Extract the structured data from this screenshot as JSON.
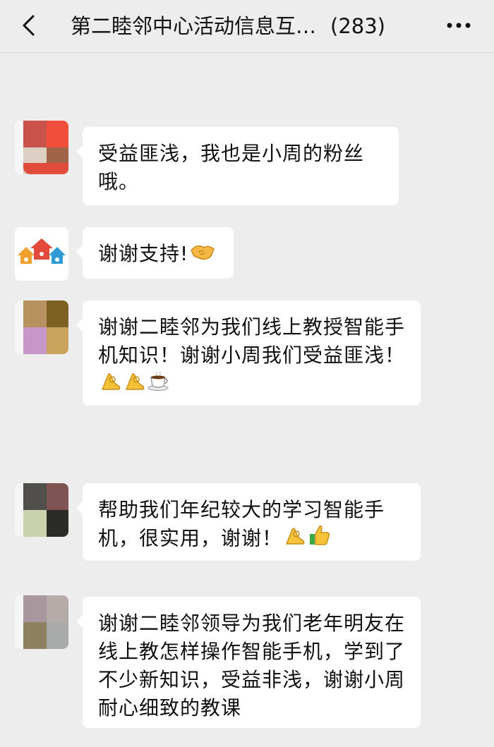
{
  "header": {
    "title": "第二睦邻中心活动信息互…",
    "member_count": "(283)",
    "back_icon": "chevron-left-icon",
    "more_icon": "more-dots-icon"
  },
  "messages": [
    {
      "text": "受益匪浅，我也是小周的粉丝哦。",
      "emojis": []
    },
    {
      "text": "谢谢支持!",
      "emojis": [
        "handshake"
      ]
    },
    {
      "text": "谢谢二睦邻为我们线上教授智能手机知识！谢谢小周我们受益匪浅！",
      "emojis": [
        "ok-hand",
        "ok-hand",
        "coffee"
      ]
    },
    {
      "text": "帮助我们年纪较大的学习智能手机，很实用，谢谢！",
      "emojis": [
        "ok-hand",
        "thumbs-up"
      ]
    },
    {
      "text": "谢谢二睦邻领导为我们老年明友在线上教怎样操作智能手机，学到了不少新知识，受益非浅，谢谢小周耐心细致的教课",
      "emojis": []
    }
  ],
  "colors": {
    "background": "#ededed",
    "bubble": "#ffffff",
    "text": "#111111"
  }
}
